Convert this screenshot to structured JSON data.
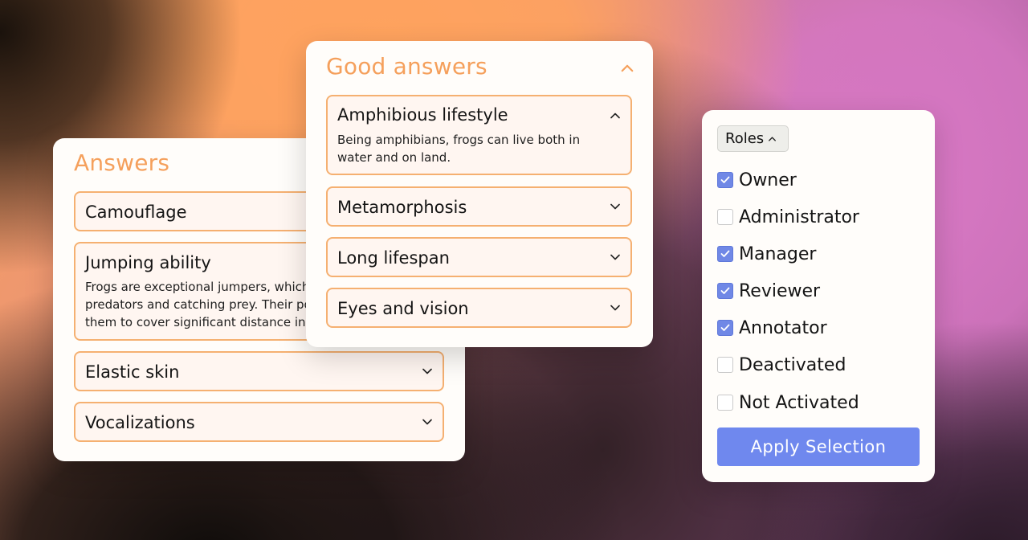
{
  "answers_card": {
    "title": "Answers",
    "items": [
      {
        "title": "Camouflage",
        "expanded": false
      },
      {
        "title": "Jumping ability",
        "expanded": true,
        "body": "Frogs are exceptional jumpers, which ai predators and catching prey. Their pow them to cover significant distance in a s"
      },
      {
        "title": "Elastic skin",
        "expanded": false
      },
      {
        "title": "Vocalizations",
        "expanded": false
      }
    ]
  },
  "good_answers_card": {
    "title": "Good answers",
    "collapse_icon": "chevron-up-icon",
    "items": [
      {
        "title": "Amphibious lifestyle",
        "expanded": true,
        "body": "Being amphibians, frogs can live both in water and on land."
      },
      {
        "title": "Metamorphosis",
        "expanded": false
      },
      {
        "title": "Long lifespan",
        "expanded": false
      },
      {
        "title": "Eyes and vision",
        "expanded": false
      }
    ]
  },
  "roles_card": {
    "dropdown_label": "Roles",
    "options": [
      {
        "label": "Owner",
        "checked": true
      },
      {
        "label": "Administrator",
        "checked": false
      },
      {
        "label": "Manager",
        "checked": true
      },
      {
        "label": "Reviewer",
        "checked": true
      },
      {
        "label": "Annotator",
        "checked": true
      },
      {
        "label": "Deactivated",
        "checked": false
      },
      {
        "label": "Not Activated",
        "checked": false
      }
    ],
    "apply_label": "Apply Selection"
  },
  "colors": {
    "accent_orange": "#f5a05c",
    "item_border": "#f5b071",
    "item_bg": "#fff6f1",
    "checkbox_blue": "#7088e6",
    "apply_button": "#6f88ee"
  }
}
